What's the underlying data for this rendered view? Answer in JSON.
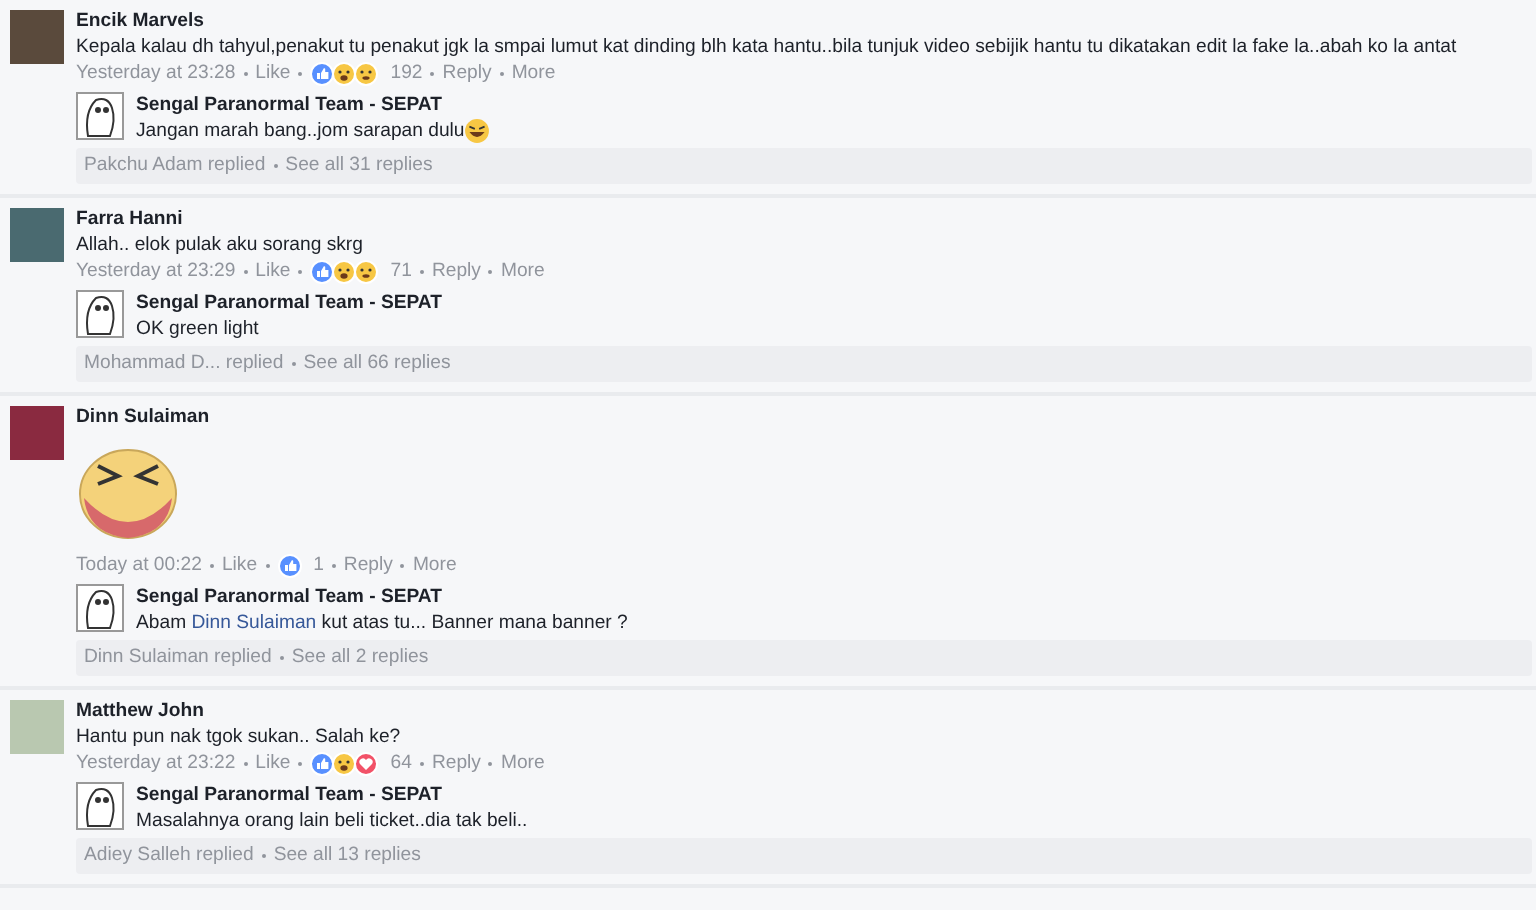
{
  "comments": [
    {
      "author": "Encik Marvels",
      "kind": "text",
      "text": "Kepala kalau dh tahyul,penakut tu penakut jgk la smpai lumut kat dinding blh kata hantu..bila tunjuk video sebijik hantu tu dikatakan edit la fake la..abah ko la antat",
      "time": "Yesterday at 23:28",
      "like": "Like",
      "reactions": [
        {
          "kind": "like"
        },
        {
          "kind": "haha"
        },
        {
          "kind": "wow"
        }
      ],
      "count": "192",
      "reply_action": "Reply",
      "more": "More",
      "reply": {
        "author": "Sengal Paranormal Team - SEPAT",
        "segments": [
          {
            "kind": "plain",
            "text": "Jangan marah bang..jom sarapan dulu"
          },
          {
            "kind": "emoji"
          }
        ]
      },
      "footer": {
        "replied": "Pakchu Adam replied",
        "see_all": "See all 31 replies"
      }
    },
    {
      "author": "Farra Hanni",
      "kind": "text",
      "text": "Allah.. elok pulak aku sorang skrg",
      "time": "Yesterday at 23:29",
      "like": "Like",
      "reactions": [
        {
          "kind": "like"
        },
        {
          "kind": "haha"
        },
        {
          "kind": "sad"
        }
      ],
      "count": "71",
      "reply_action": "Reply",
      "more": "More",
      "reply": {
        "author": "Sengal Paranormal Team - SEPAT",
        "segments": [
          {
            "kind": "plain",
            "text": "OK green light"
          }
        ]
      },
      "footer": {
        "replied": "Mohammad D... replied",
        "see_all": "See all 66 replies"
      }
    },
    {
      "author": "Dinn Sulaiman",
      "kind": "sticker",
      "time": "Today at 00:22",
      "like": "Like",
      "reactions": [
        {
          "kind": "like"
        }
      ],
      "count": "1",
      "reply_action": "Reply",
      "more": "More",
      "reply": {
        "author": "Sengal Paranormal Team - SEPAT",
        "segments": [
          {
            "kind": "plain",
            "text": "Abam "
          },
          {
            "kind": "link",
            "text": "Dinn Sulaiman"
          },
          {
            "kind": "plain",
            "text": " kut atas tu... Banner mana banner ?"
          }
        ]
      },
      "footer": {
        "replied": "Dinn Sulaiman replied",
        "see_all": "See all 2 replies"
      }
    },
    {
      "author": "Matthew John",
      "kind": "text",
      "text": "Hantu pun nak tgok sukan.. Salah ke?",
      "time": "Yesterday at 23:22",
      "like": "Like",
      "reactions": [
        {
          "kind": "like"
        },
        {
          "kind": "haha"
        },
        {
          "kind": "love"
        }
      ],
      "count": "64",
      "reply_action": "Reply",
      "more": "More",
      "reply": {
        "author": "Sengal Paranormal Team - SEPAT",
        "segments": [
          {
            "kind": "plain",
            "text": "Masalahnya orang lain beli ticket..dia tak beli.."
          }
        ]
      },
      "footer": {
        "replied": "Adiey Salleh replied",
        "see_all": "See all 13 replies"
      }
    }
  ]
}
